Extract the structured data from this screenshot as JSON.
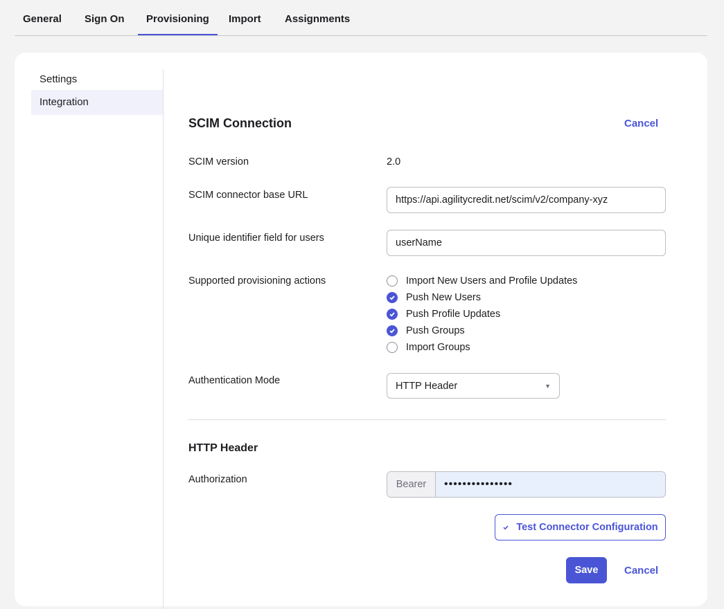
{
  "tabs": [
    {
      "label": "General"
    },
    {
      "label": "Sign On"
    },
    {
      "label": "Provisioning",
      "active": true
    },
    {
      "label": "Import"
    },
    {
      "label": "Assignments"
    }
  ],
  "sidebar": {
    "heading": "Settings",
    "items": [
      {
        "label": "Integration",
        "selected": true
      }
    ]
  },
  "scim": {
    "title": "SCIM Connection",
    "cancel_label": "Cancel",
    "version_label": "SCIM version",
    "version_value": "2.0",
    "base_url_label": "SCIM connector base URL",
    "base_url_value": "https://api.agilitycredit.net/scim/v2/company-xyz",
    "unique_id_label": "Unique identifier field for users",
    "unique_id_value": "userName",
    "actions_label": "Supported provisioning actions",
    "actions": [
      {
        "label": "Import New Users and Profile Updates",
        "checked": false
      },
      {
        "label": "Push New Users",
        "checked": true
      },
      {
        "label": "Push Profile Updates",
        "checked": true
      },
      {
        "label": "Push Groups",
        "checked": true
      },
      {
        "label": "Import Groups",
        "checked": false
      }
    ],
    "auth_mode_label": "Authentication Mode",
    "auth_mode_value": "HTTP Header"
  },
  "http_header": {
    "title": "HTTP Header",
    "authorization_label": "Authorization",
    "prefix": "Bearer",
    "token_masked": "•••••••••••••••"
  },
  "actions": {
    "test_label": "Test Connector Configuration",
    "save_label": "Save",
    "cancel_label": "Cancel"
  },
  "colors": {
    "accent": "#4a55d6",
    "autofill": "#e8f0fe"
  }
}
